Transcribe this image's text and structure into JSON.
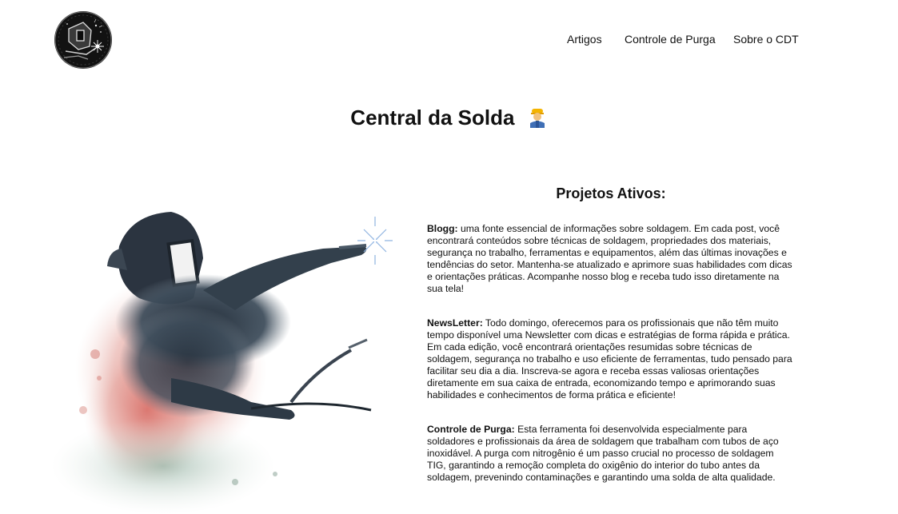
{
  "nav": {
    "items": [
      {
        "label": "Artigos"
      },
      {
        "label": "Controle de Purga"
      },
      {
        "label": "Sobre o CDT"
      }
    ]
  },
  "header": {
    "title": "Central da Solda",
    "emoji": "worker-icon"
  },
  "projects": {
    "title": "Projetos Ativos:",
    "items": [
      {
        "name": "Blogg:",
        "text": " uma fonte essencial de informações sobre soldagem. Em cada post, você encontrará conteúdos sobre técnicas de soldagem, propriedades dos materiais, segurança no trabalho, ferramentas e equipamentos, além das últimas inovações e tendências do setor. Mantenha-se atualizado e aprimore suas habilidades com dicas e orientações práticas. Acompanhe nosso blog e receba tudo isso diretamente na sua tela!"
      },
      {
        "name": "NewsLetter:",
        "text": " Todo domingo, oferecemos para os profissionais que não têm muito tempo disponível uma Newsletter com dicas e estratégias de forma rápida e prática. Em cada edição, você encontrará orientações resumidas sobre técnicas de soldagem, segurança no trabalho e uso eficiente de ferramentas, tudo pensado para facilitar seu dia a dia. Inscreva-se agora e receba essas valiosas orientações diretamente em sua caixa de entrada, economizando tempo e aprimorando suas habilidades e conhecimentos de forma prática e eficiente!"
      },
      {
        "name": "Controle de Purga:",
        "text": " Esta ferramenta foi desenvolvida especialmente para soldadores e profissionais da área de soldagem que trabalham com tubos de aço inoxidável. A purga com nitrogênio é um passo crucial no processo de soldagem TIG, garantindo a remoção completa do oxigênio do interior do tubo antes da soldagem, prevenindo contaminações e garantindo uma solda de alta qualidade."
      }
    ]
  },
  "colors": {
    "text": "#111111",
    "background": "#ffffff",
    "logo_bg": "#111111"
  }
}
